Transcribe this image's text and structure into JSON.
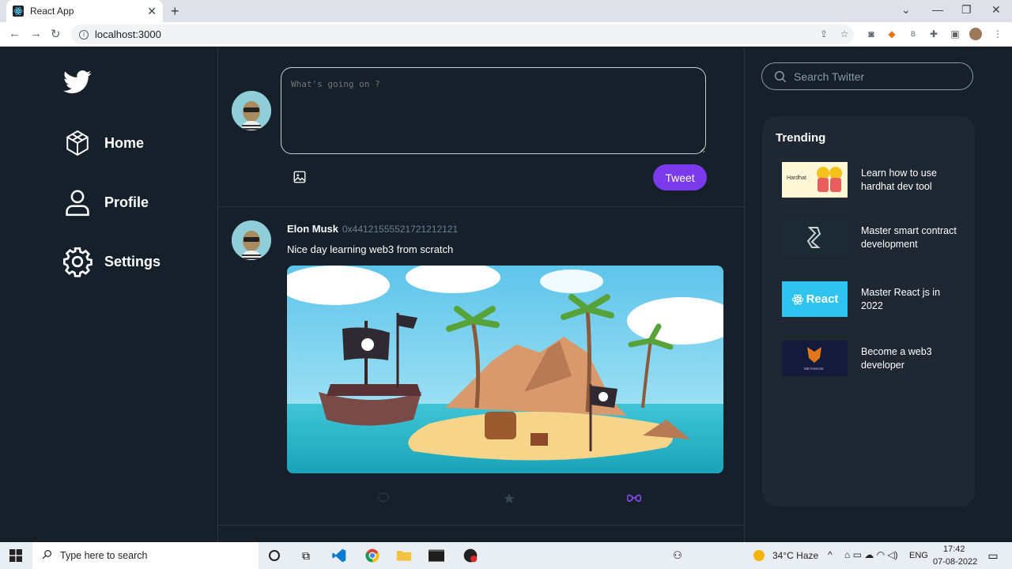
{
  "browser": {
    "tab_title": "React App",
    "url": "localhost:3000"
  },
  "nav": {
    "items": [
      {
        "label": "Home",
        "icon": "cube-icon"
      },
      {
        "label": "Profile",
        "icon": "user-icon"
      },
      {
        "label": "Settings",
        "icon": "gear-icon"
      }
    ]
  },
  "composer": {
    "placeholder": "What's going on ?",
    "tweet_button": "Tweet"
  },
  "post": {
    "author": "Elon Musk",
    "wallet": "0x4412155552172121212​1",
    "text": "Nice day learning web3 from scratch"
  },
  "search": {
    "placeholder": "Search Twitter"
  },
  "trending": {
    "title": "Trending",
    "items": [
      {
        "text": "Learn how to use hardhat dev tool",
        "thumb_label": "Hardhat"
      },
      {
        "text": "Master smart contract development",
        "thumb_label": ""
      },
      {
        "text": "Master React js in 2022",
        "thumb_label": "React"
      },
      {
        "text": "Become a web3 developer",
        "thumb_label": "METAMASK"
      }
    ]
  },
  "taskbar": {
    "search_text": "Type here to search",
    "weather": "34°C  Haze",
    "lang": "ENG",
    "time": "17:42",
    "date": "07-08-2022"
  },
  "colors": {
    "background": "#15202b",
    "accent": "#7c3aed",
    "card": "#1e2732"
  }
}
